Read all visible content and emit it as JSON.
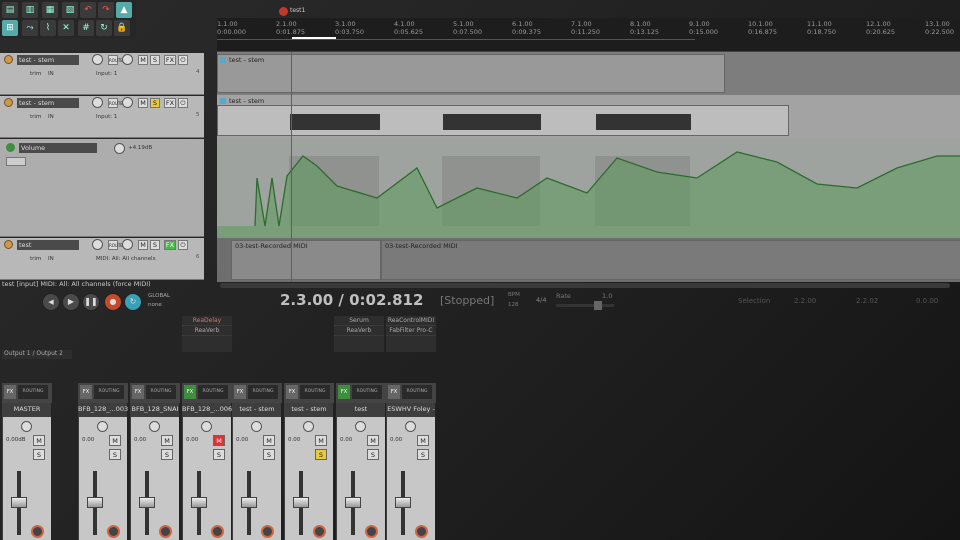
{
  "toolbar": {
    "buttons": [
      "new-project",
      "open-project",
      "save-project",
      "project-settings",
      "undo",
      "redo",
      "metronome",
      "grid-snap",
      "ripple-edit",
      "envelope-link",
      "auto-crossfade",
      "item-grouping",
      "grid",
      "mixer-lock",
      "loop",
      "lock"
    ],
    "active_label": "auto"
  },
  "ruler": {
    "marker": "test1",
    "bars": [
      "1.1.00",
      "2.1.00",
      "3.1.00",
      "4.1.00",
      "5.1.00",
      "6.1.00",
      "7.1.00",
      "8.1.00",
      "9.1.00",
      "10.1.00",
      "11.1.00",
      "12.1.00",
      "13.1.00"
    ],
    "times": [
      "0:00.000",
      "0:01.875",
      "0:03.750",
      "0:05.625",
      "0:07.500",
      "0:09.375",
      "0:11.250",
      "0:13.125",
      "0:15.000",
      "0:16.875",
      "0:18.750",
      "0:20.625",
      "0:22.500"
    ]
  },
  "tracks": [
    {
      "name": "test - stem",
      "num": "4",
      "input": "Input: 1",
      "in_label": "IN",
      "trim": "trim",
      "fx": "FX",
      "io": "ROUTE",
      "m": "M",
      "s": "S",
      "phase": "ø"
    },
    {
      "name": "test - stem",
      "num": "5",
      "input": "Input: 1",
      "in_label": "IN",
      "trim": "trim",
      "fx": "FX",
      "io": "ROUTE",
      "m": "M",
      "s": "S",
      "phase": "ø"
    },
    {
      "name": "test",
      "num": "6",
      "input": "MIDI: All: All channels",
      "in_label": "IN",
      "trim": "trim",
      "fx": "FX",
      "io": "ROUTE",
      "m": "M",
      "s": "S",
      "phase": "ø"
    }
  ],
  "envelope": {
    "name": "Volume",
    "value": "+4.19dB"
  },
  "items": {
    "track4": "test - stem",
    "track5": "test - stem",
    "midi1": "03-test-Recorded MIDI",
    "midi2": "03-test-Recorded MIDI"
  },
  "status_bar": "test [input] MIDI: All: All channels (force MIDI)",
  "transport": {
    "buttons": [
      "rewind",
      "stop",
      "play",
      "pause",
      "record",
      "repeat"
    ],
    "global_label": "GLOBAL",
    "global_mode": "none",
    "position": "2.3.00 / 0:02.812",
    "state": "[Stopped]",
    "bpm_label": "BPM",
    "bpm": "128",
    "time_sig": "4/4",
    "rate_label": "Rate",
    "rate": "1.0",
    "selection_label": "Selection",
    "sel_start": "2.2.00",
    "sel_end": "2.2.02",
    "sel_len": "0.0.00"
  },
  "fx_slots": [
    [
      "ReaDelay",
      "ReaVerb"
    ],
    [
      "Serum",
      "ReaVerb"
    ],
    [
      "ReaControlMIDI",
      "FabFilter Pro-C"
    ]
  ],
  "master_output": "Output 1 / Output 2",
  "mixer": [
    {
      "name": "MASTER",
      "vol": "0.00dB",
      "m": "M",
      "s": "S",
      "muted": false,
      "soloed": false,
      "fx_active": false
    },
    {
      "name": "BFB_128_...003",
      "vol": "0.00",
      "m": "M",
      "s": "S",
      "muted": false,
      "soloed": false,
      "fx_active": false
    },
    {
      "name": "BFB_128_SNAI",
      "vol": "0.00",
      "m": "M",
      "s": "S",
      "muted": false,
      "soloed": false,
      "fx_active": false
    },
    {
      "name": "BFB_128_...006",
      "vol": "0.00",
      "m": "M",
      "s": "S",
      "muted": true,
      "soloed": false,
      "fx_active": true
    },
    {
      "name": "test - stem",
      "vol": "0.00",
      "m": "M",
      "s": "S",
      "muted": false,
      "soloed": false,
      "fx_active": false
    },
    {
      "name": "test - stem",
      "vol": "0.00",
      "m": "M",
      "s": "S",
      "muted": false,
      "soloed": true,
      "fx_active": false
    },
    {
      "name": "test",
      "vol": "0.00",
      "m": "M",
      "s": "S",
      "muted": false,
      "soloed": false,
      "fx_active": true
    },
    {
      "name": "ESWHV Foley -",
      "vol": "0.00",
      "m": "M",
      "s": "S",
      "muted": false,
      "soloed": false,
      "fx_active": false
    }
  ],
  "mixer_labels": {
    "fx": "FX",
    "routing": "ROUTING",
    "mono": "MONO",
    "trim": "trim",
    "in": "IN"
  },
  "meter_scale": [
    "-inf",
    "12",
    "6",
    "0",
    "-6",
    "-12",
    "-18",
    "-24",
    "-30",
    "-36",
    "-42",
    "-54"
  ],
  "fader_scale": [
    "-6",
    "-18",
    "-30",
    "-42",
    "-54"
  ],
  "colors": {
    "accent": "#3d8e3d",
    "record": "#c64a2a",
    "solo": "#e8c93a",
    "mute_active": "#d33333",
    "cursor": "#c0392b"
  }
}
